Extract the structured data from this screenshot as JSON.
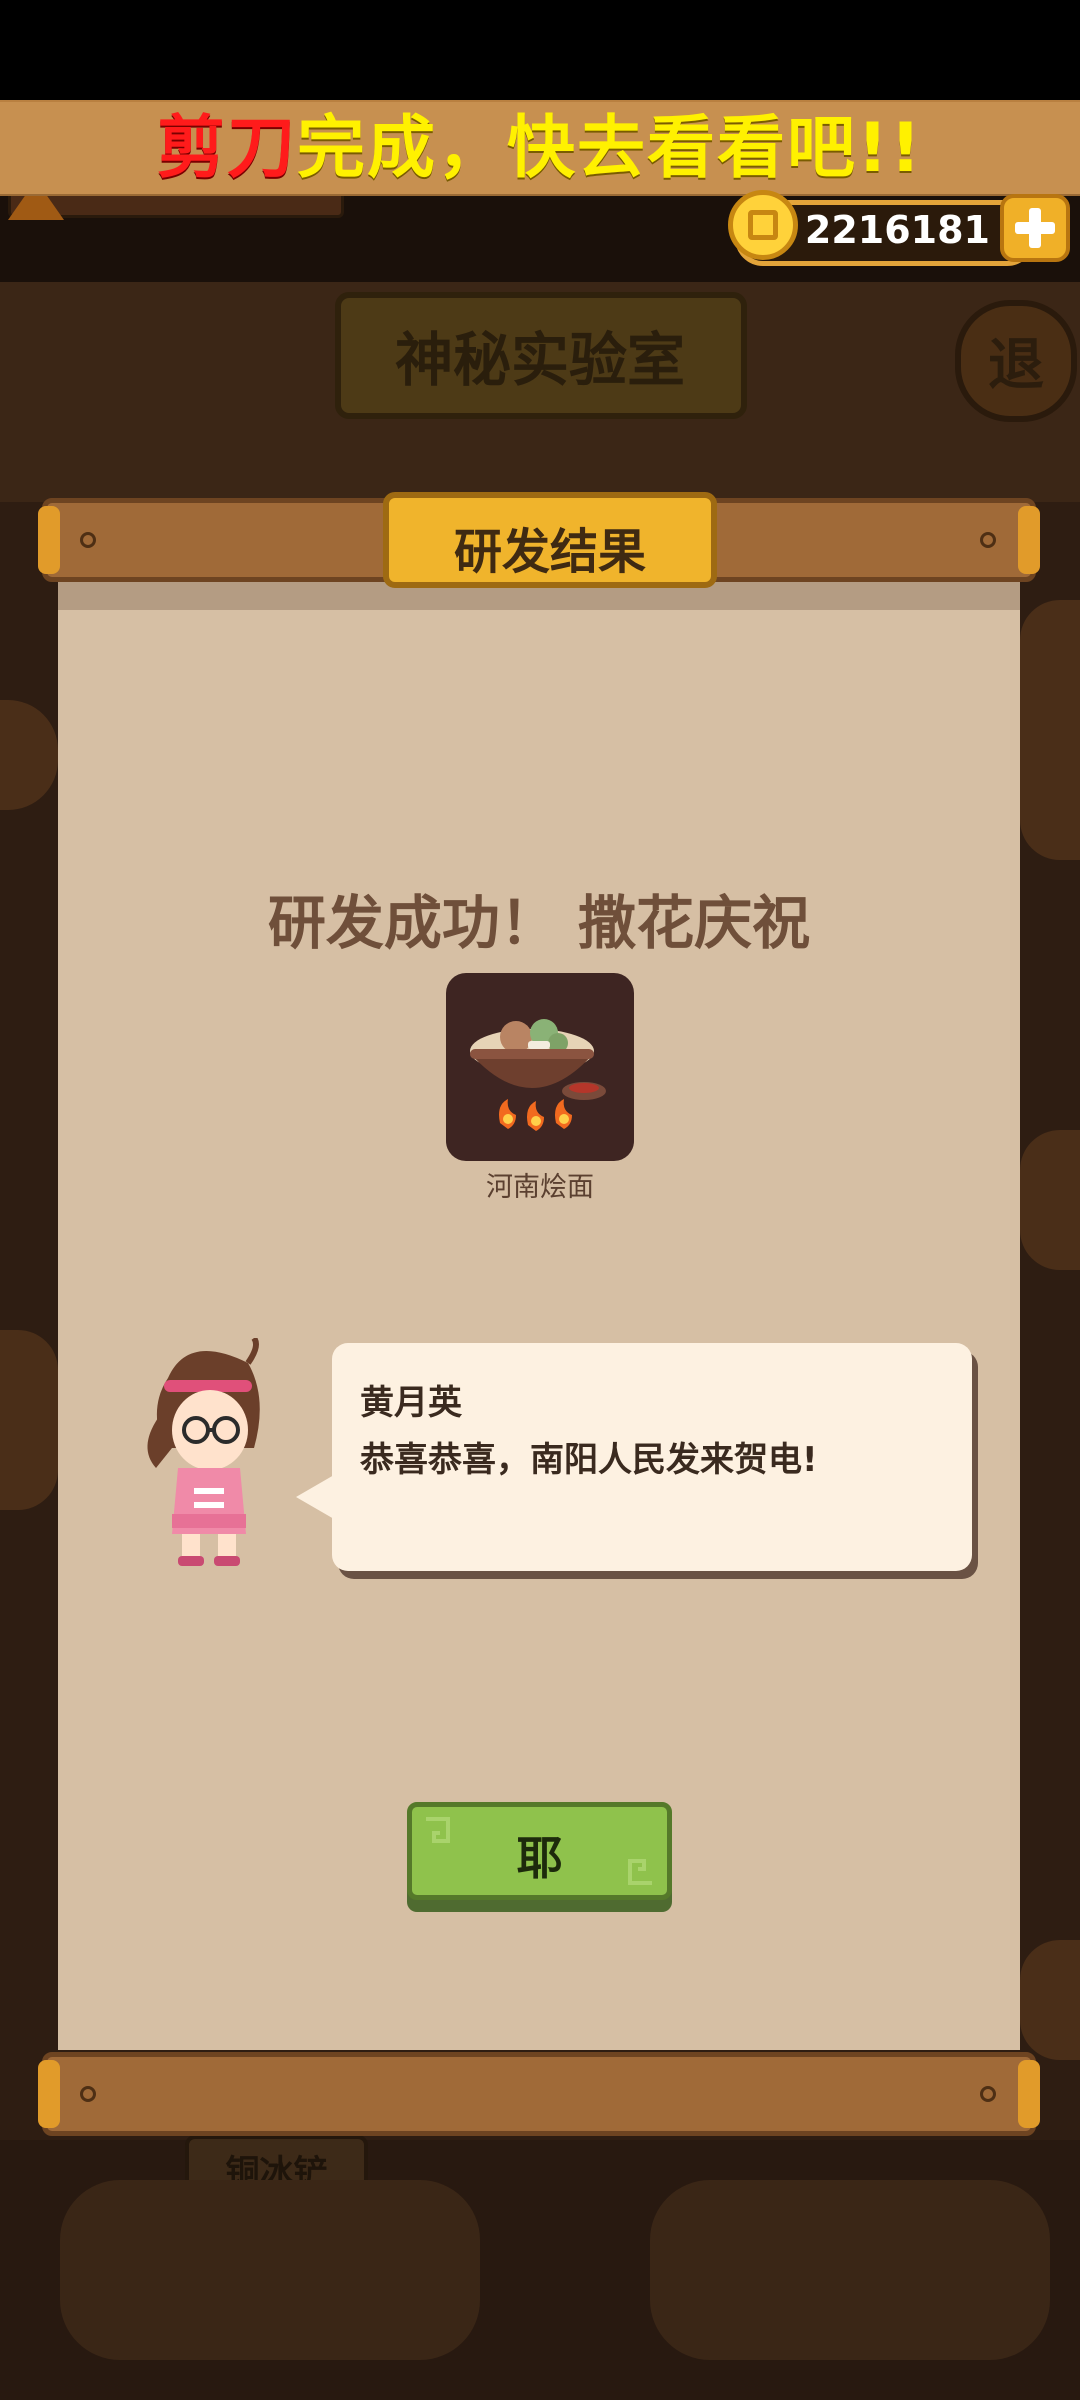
{
  "banner": {
    "red_part": "剪刀",
    "yellow_part": "完成，快去看看吧!!"
  },
  "currency": {
    "coins": "2216181",
    "coin_icon": "copper-coin-icon",
    "add_icon": "plus-icon"
  },
  "background": {
    "room_title": "神秘实验室",
    "exit_label": "退",
    "tool_label": "铜冰铲"
  },
  "dialog": {
    "title": "研发结果",
    "message": "研发成功！ 撒花庆祝",
    "dish": {
      "name": "河南烩面",
      "icon": "noodle-pot-icon"
    },
    "speaker": {
      "name": "黄月英",
      "line": "恭喜恭喜，南阳人民发来贺电!",
      "avatar": "girl-with-glasses-avatar"
    },
    "confirm_label": "耶"
  },
  "colors": {
    "banner_bg": "#c79050",
    "panel_bg": "#d6bfa4",
    "title_plate": "#f0b42c",
    "confirm_button": "#8fc24c",
    "highlight_red": "#ff1b1b",
    "highlight_yellow": "#fff100"
  }
}
